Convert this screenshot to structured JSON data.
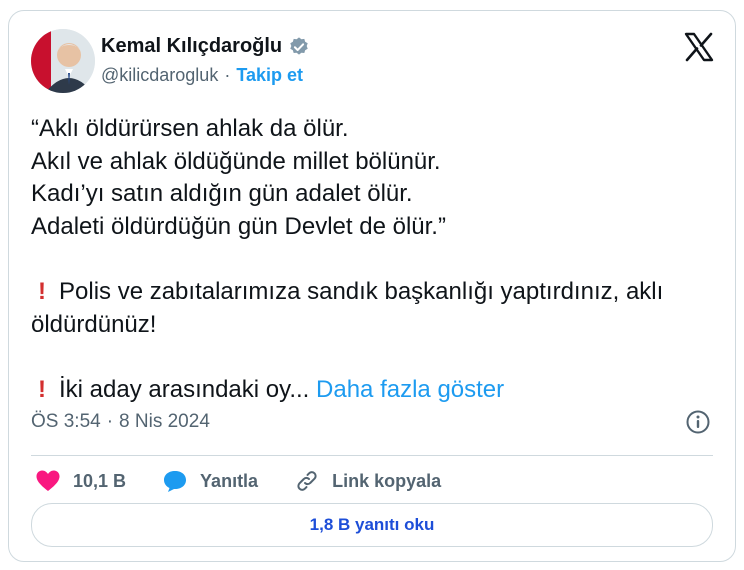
{
  "header": {
    "name": "Kemal Kılıçdaroğlu",
    "handle": "@kilicdarogluk",
    "separator": "·",
    "follow_label": "Takip et"
  },
  "tweet": {
    "lines_quote": [
      "“Aklı öldürürsen ahlak da ölür.",
      "Akıl ve ahlak öldüğünde millet bölünür.",
      "Kadı’yı satın aldığın gün adalet ölür.",
      "Adaleti öldürdüğün gün Devlet de ölür.”"
    ],
    "bullet_1": "Polis ve zabıtalarımıza sandık başkanlığı yaptırdınız, aklı öldürdünüz!",
    "bullet_2": "İki aday arasındaki oy...",
    "show_more": "Daha fazla göster",
    "exclamation_glyph": "!"
  },
  "meta": {
    "time": "ÖS 3:54",
    "separator": "·",
    "date": "8 Nis 2024"
  },
  "actions": {
    "likes": "10,1 B",
    "reply_label": "Yanıtla",
    "copy_link_label": "Link kopyala"
  },
  "footer": {
    "read_replies_label": "1,8 B yanıtı oku"
  },
  "colors": {
    "accent": "#1d9bf0",
    "heart": "#f91880",
    "exclamation": "#d32f2f",
    "text": "#0f1419",
    "secondary": "#536471"
  },
  "icons": [
    "verified-badge-icon",
    "x-logo-icon",
    "info-icon",
    "heart-icon",
    "reply-icon",
    "link-icon",
    "exclamation-icon"
  ]
}
